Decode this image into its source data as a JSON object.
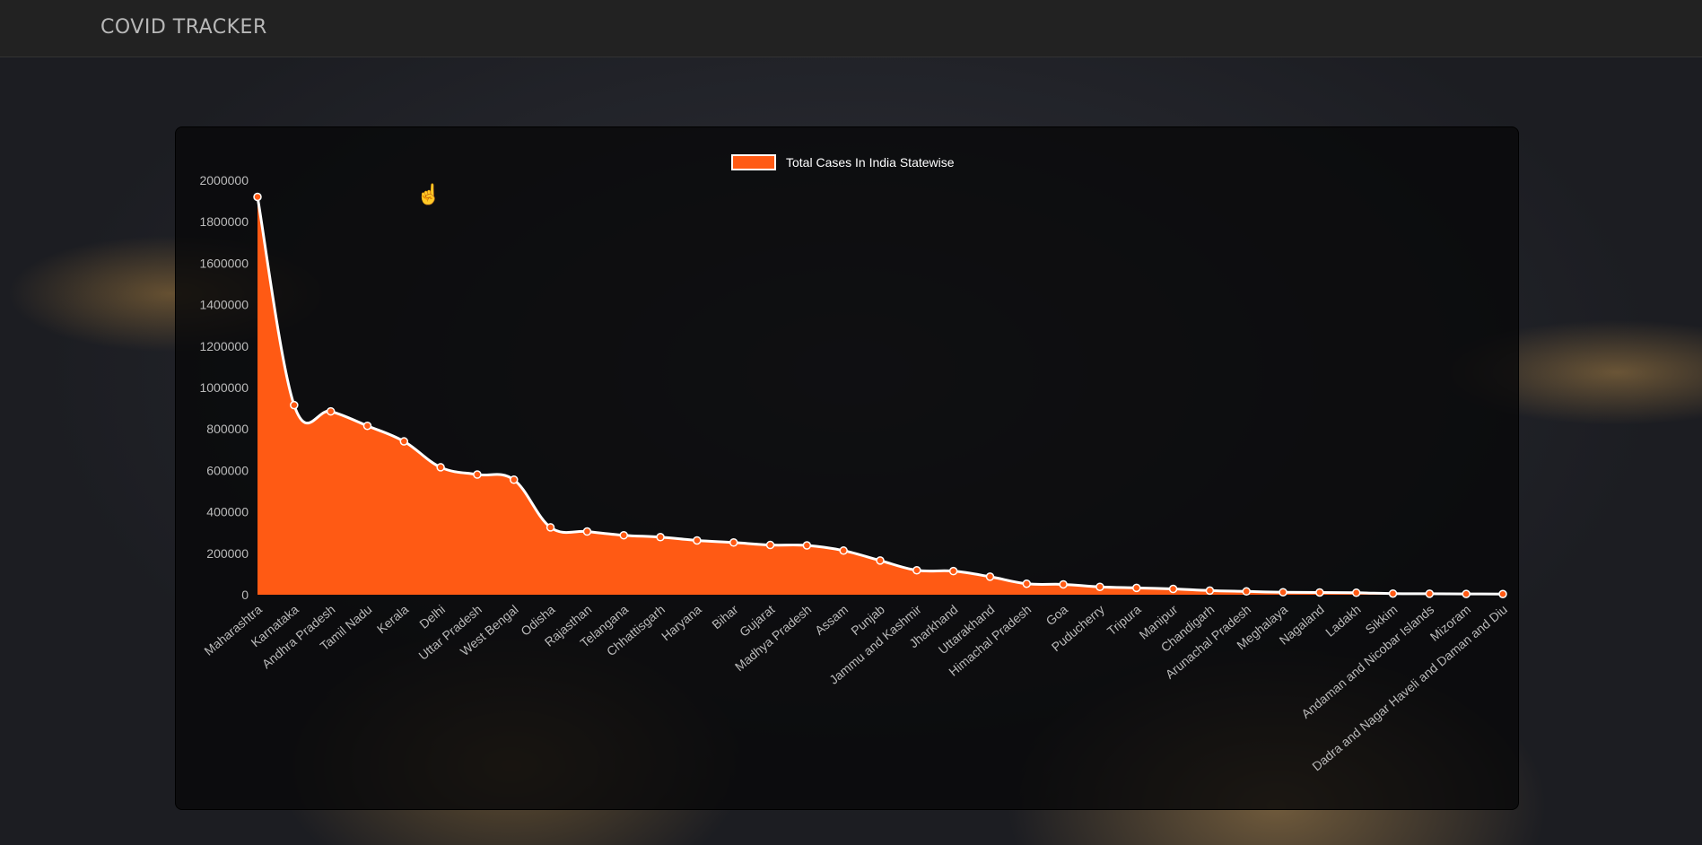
{
  "navbar": {
    "brand": "COVID TRACKER"
  },
  "colors": {
    "area": "#ff5a14",
    "line": "#ffffff",
    "point_fill": "#ff5a14",
    "text": "#ffffff",
    "tick": "#bbbbbb"
  },
  "chart_data": {
    "type": "area",
    "title": "",
    "legend": {
      "position": "top",
      "label": "Total Cases In India Statewise"
    },
    "ylim": [
      0,
      2000000
    ],
    "yticks": [
      0,
      200000,
      400000,
      600000,
      800000,
      1000000,
      1200000,
      1400000,
      1600000,
      1800000,
      2000000
    ],
    "categories": [
      "Maharashtra",
      "Karnataka",
      "Andhra Pradesh",
      "Tamil Nadu",
      "Kerala",
      "Delhi",
      "Uttar Pradesh",
      "West Bengal",
      "Odisha",
      "Rajasthan",
      "Telangana",
      "Chhattisgarh",
      "Haryana",
      "Bihar",
      "Gujarat",
      "Madhya Pradesh",
      "Assam",
      "Punjab",
      "Jammu and Kashmir",
      "Jharkhand",
      "Uttarakhand",
      "Himachal Pradesh",
      "Goa",
      "Puducherry",
      "Tripura",
      "Manipur",
      "Chandigarh",
      "Arunachal Pradesh",
      "Meghalaya",
      "Nagaland",
      "Ladakh",
      "Sikkim",
      "Andaman and Nicobar Islands",
      "Mizoram",
      "Dadra and Nagar Haveli and Daman and Diu"
    ],
    "series": [
      {
        "name": "Total Cases In India Statewise",
        "values": [
          1920000,
          915000,
          885000,
          815000,
          740000,
          615000,
          580000,
          555000,
          325000,
          305000,
          287000,
          278000,
          262000,
          252000,
          240000,
          238000,
          213000,
          165000,
          118000,
          114000,
          87000,
          53000,
          50000,
          38000,
          33000,
          28000,
          20000,
          16000,
          12000,
          11000,
          9500,
          5500,
          4800,
          3800,
          3300
        ]
      }
    ]
  }
}
